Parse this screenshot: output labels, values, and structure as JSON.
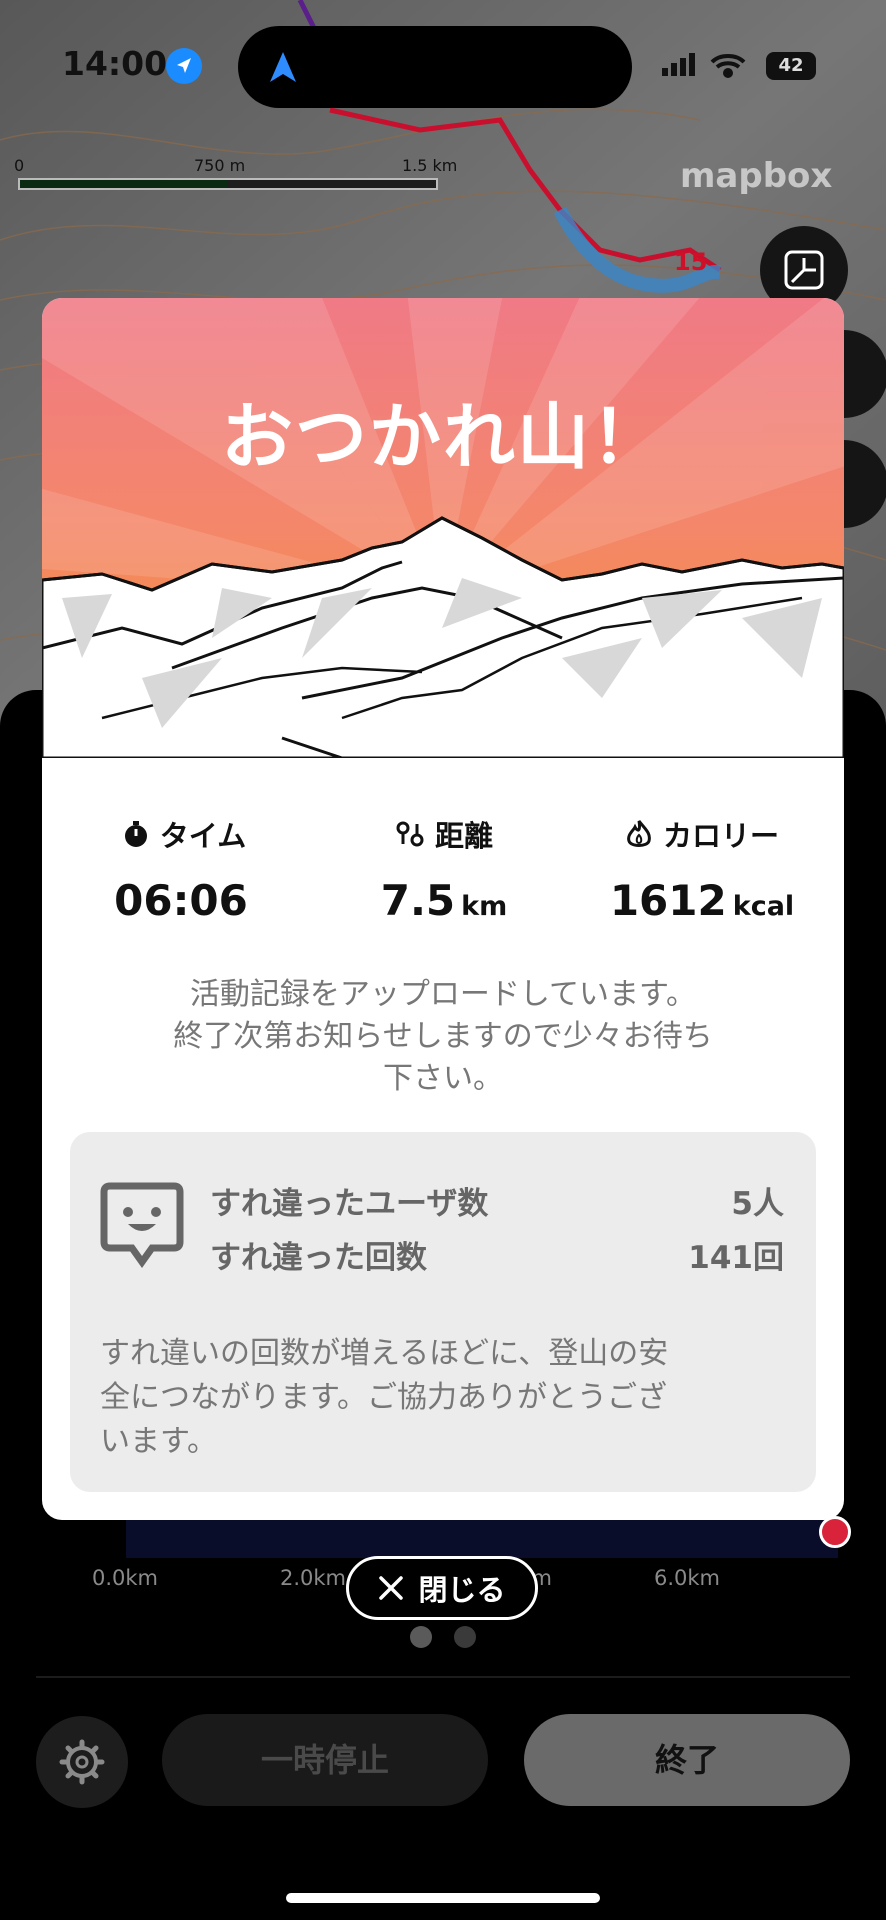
{
  "status_bar": {
    "time": "14:00",
    "battery": "42"
  },
  "map": {
    "scale_labels": [
      "0",
      "750 m",
      "1.5 km"
    ],
    "attribution": "mapbox",
    "route_marker": "15",
    "icons": [
      "location-arrow-icon",
      "navigation-arrow-icon",
      "collapse-icon",
      "cellular-icon",
      "wifi-icon"
    ]
  },
  "modal": {
    "title": "おつかれ山！",
    "stats": [
      {
        "icon": "stopwatch-icon",
        "label": "タイム",
        "value": "06:06",
        "unit": ""
      },
      {
        "icon": "route-icon",
        "label": "距離",
        "value": "7.5",
        "unit": "km"
      },
      {
        "icon": "flame-icon",
        "label": "カロリー",
        "value": "1612",
        "unit": "kcal"
      }
    ],
    "upload_message_line1": "活動記録をアップロードしています。",
    "upload_message_line2": "終了次第お知らせしますので少々お待ち",
    "upload_message_line3": "下さい。",
    "encounters": {
      "users_label": "すれ違ったユーザ数",
      "users_value": "5人",
      "count_label": "すれ違った回数",
      "count_value": "141回",
      "note_line1": "すれ違いの回数が増えるほどに、登山の安",
      "note_line2": "全につながります。ご協力ありがとうござ",
      "note_line3": "います。"
    },
    "close_label": "閉じる"
  },
  "sheet": {
    "x_ticks": [
      "0.0km",
      "2.0km",
      "4.0km",
      "6.0km"
    ],
    "pause_label": "一時停止",
    "end_label": "終了"
  },
  "colors": {
    "hero_top": "#f07a86",
    "hero_bottom": "#f5902a",
    "route": "#c8102e",
    "accent_blue": "#1a8cff"
  }
}
